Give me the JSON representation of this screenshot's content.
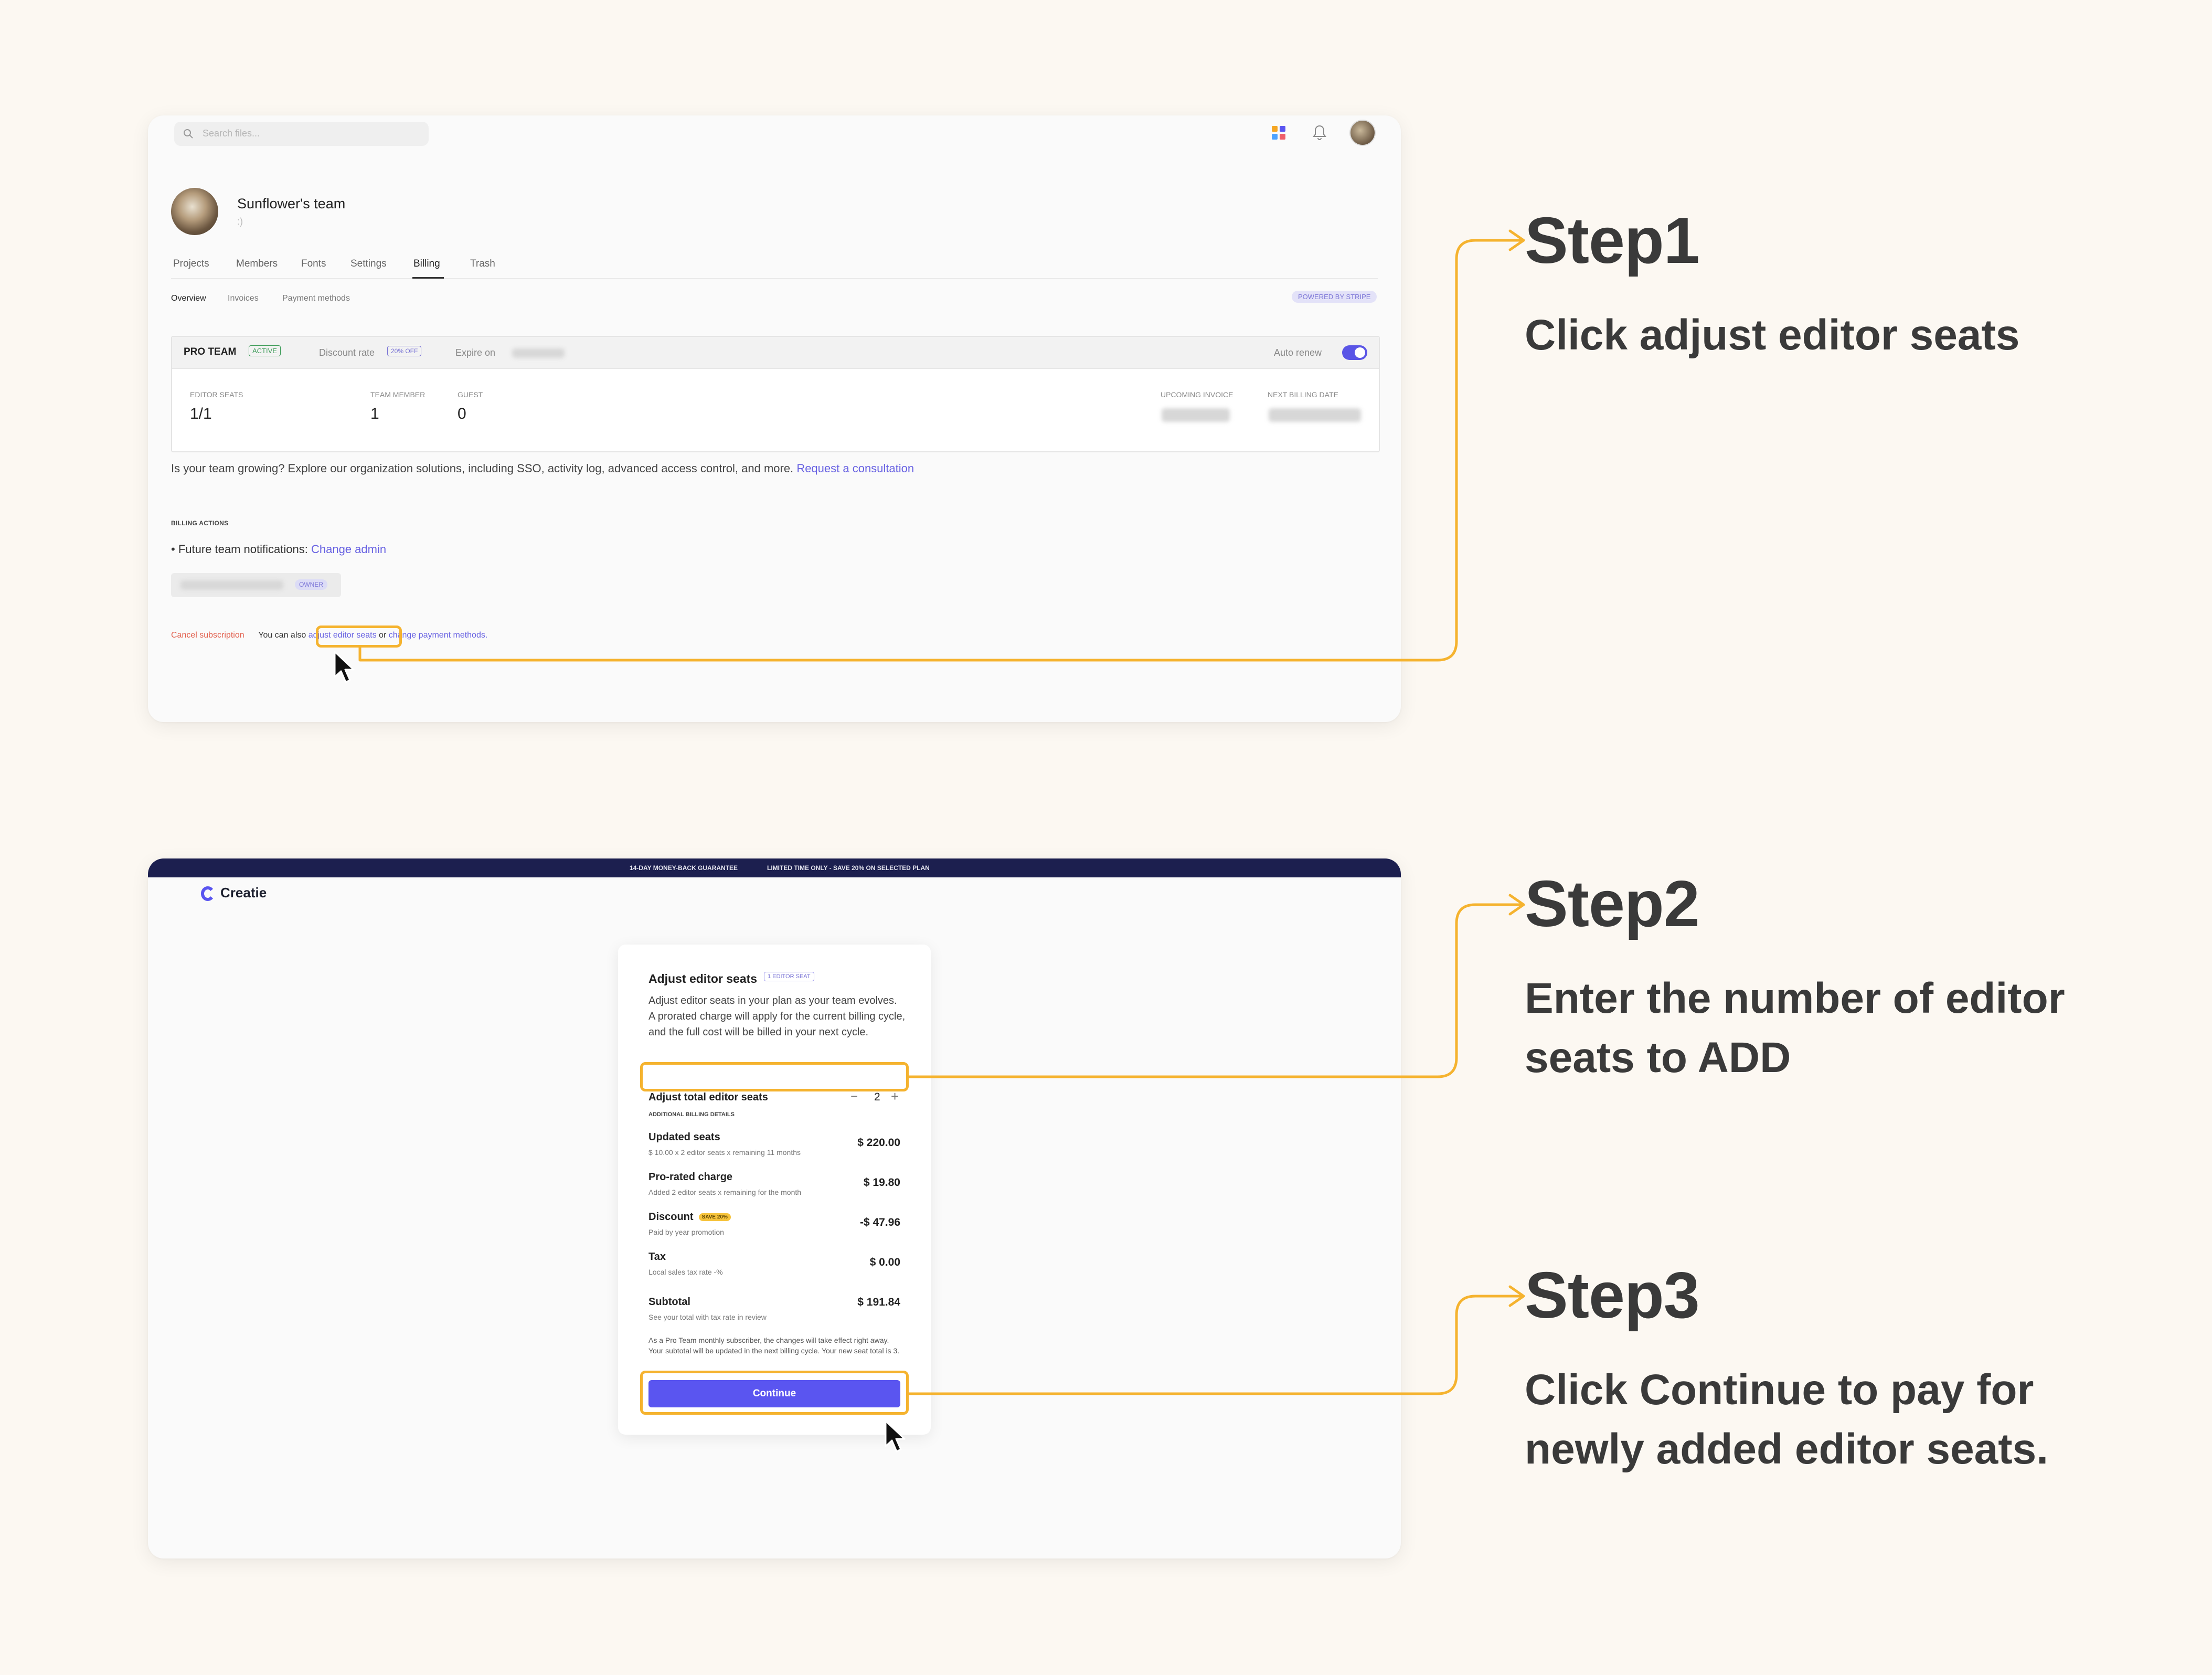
{
  "panel1": {
    "search_placeholder": "Search files...",
    "team_name": "Sunflower's team",
    "team_subtitle": ":)",
    "tabs": [
      "Projects",
      "Members",
      "Fonts",
      "Settings",
      "Billing",
      "Trash"
    ],
    "active_tab": "Billing",
    "subtabs": [
      "Overview",
      "Invoices",
      "Payment methods"
    ],
    "active_subtab": "Overview",
    "powered_badge": "POWERED BY STRIPE",
    "plan": {
      "name": "PRO TEAM",
      "status": "ACTIVE",
      "discount_label": "Discount rate",
      "discount_badge": "20% OFF",
      "expire_label": "Expire on",
      "auto_renew_label": "Auto renew",
      "auto_renew_on": true
    },
    "stats": {
      "editor_seats_label": "EDITOR SEATS",
      "editor_seats_value": "1/1",
      "team_member_label": "TEAM MEMBER",
      "team_member_value": "1",
      "guest_label": "GUEST",
      "guest_value": "0",
      "upcoming_invoice_label": "UPCOMING INVOICE",
      "next_billing_label": "NEXT BILLING DATE"
    },
    "growing_text": "Is your team growing? Explore our organization solutions, including SSO, activity log, advanced access control, and more.",
    "growing_link": "Request a consultation",
    "billing_actions_title": "BILLING ACTIONS",
    "future_notifications_label": "Future team notifications:",
    "change_admin_link": "Change admin",
    "owner_badge": "OWNER",
    "cancel_link": "Cancel subscription",
    "also_text": "You can also",
    "adjust_link": "adjust editor seats",
    "or_text": "or",
    "change_payment_link": "change payment methods."
  },
  "panel2": {
    "banner_left": "14-DAY MONEY-BACK GUARANTEE",
    "banner_right": "LIMITED TIME ONLY - SAVE 20% ON SELECTED PLAN",
    "logo_text": "Creatie",
    "modal": {
      "title": "Adjust editor seats",
      "seat_badge": "1 EDITOR SEAT",
      "description": "Adjust editor seats in your plan as your team evolves. A prorated charge will apply for the current billing cycle, and the full cost will be billed in your next cycle.",
      "adjust_label": "Adjust total editor seats",
      "minus": "−",
      "seat_count": "2",
      "plus": "+",
      "section_title": "ADDITIONAL BILLING DETAILS",
      "items": [
        {
          "title": "Updated seats",
          "subtitle": "$ 10.00 x 2 editor seats x remaining 11 months",
          "amount": "$ 220.00"
        },
        {
          "title": "Pro-rated charge",
          "subtitle": "Added 2 editor seats x remaining for the month",
          "amount": "$ 19.80"
        },
        {
          "title": "Discount",
          "badge": "SAVE 20%",
          "subtitle": "Paid by year promotion",
          "amount": "-$ 47.96"
        },
        {
          "title": "Tax",
          "subtitle": "Local sales tax rate -%",
          "amount": "$ 0.00"
        }
      ],
      "subtotal_title": "Subtotal",
      "subtotal_subtitle": "See your total with tax rate in review",
      "subtotal_amount": "$ 191.84",
      "note": "As a Pro Team monthly subscriber, the changes will take effect right away. Your subtotal will be updated in the next billing cycle. Your new seat total is 3.",
      "continue_label": "Continue"
    }
  },
  "steps": [
    {
      "title": "Step1",
      "description": "Click adjust editor seats"
    },
    {
      "title": "Step2",
      "description": "Enter the number of editor seats to ADD"
    },
    {
      "title": "Step3",
      "description": "Click Continue to pay for newly added editor seats."
    }
  ],
  "colors": {
    "page_bg": "#fcf8f2",
    "accent": "#5a55f0",
    "highlight": "#f5b32f",
    "banner": "#1c1f4f",
    "cancel": "#e2604e"
  }
}
